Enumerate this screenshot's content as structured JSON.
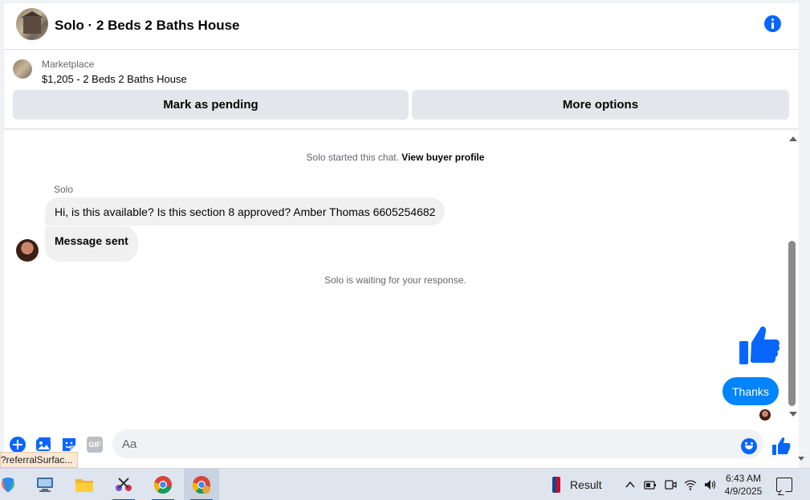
{
  "header": {
    "title": "Solo · 2 Beds 2 Baths House",
    "info_icon": "info-icon"
  },
  "listing": {
    "label": "Marketplace",
    "title": "$1,205 - 2 Beds 2 Baths House",
    "buttons": {
      "mark_pending": "Mark as pending",
      "more_options": "More options"
    }
  },
  "conversation": {
    "started_text": "Solo started this chat.",
    "view_profile_link": "View buyer profile",
    "sender_name": "Solo",
    "incoming": [
      "Hi, is this available? Is this section 8 approved? Amber Thomas 6605254682",
      "Message sent"
    ],
    "waiting_text": "Solo is waiting for your response.",
    "outgoing": [
      "Thanks"
    ]
  },
  "composer": {
    "placeholder": "Aa",
    "gif_label": "GIF"
  },
  "status_tip": "?referralSurfac...",
  "taskbar": {
    "weather_label": "Result",
    "time": "6:43 AM",
    "date": "4/9/2025"
  },
  "colors": {
    "accent": "#0866ff",
    "outgoing_bubble": "#0084ff",
    "incoming_bubble": "#f0f0f0",
    "button_bg": "#e4e6eb"
  }
}
